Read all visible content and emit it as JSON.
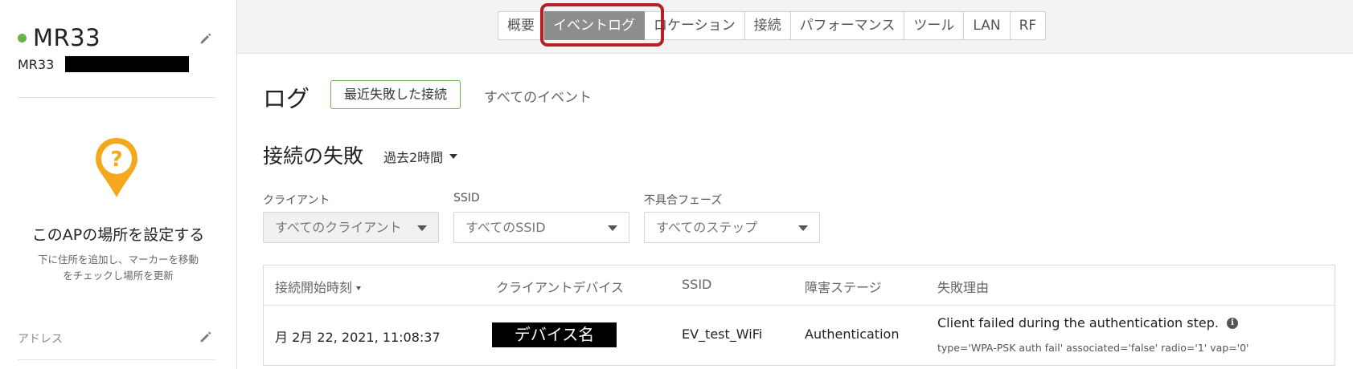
{
  "sidebar": {
    "ap_name": "MR33",
    "ap_model": "MR33",
    "location_title": "このAPの場所を設定する",
    "location_desc_line1": "下に住所を追加し、マーカーを移動",
    "location_desc_line2": "をチェックし場所を更新",
    "address_label": "アドレス"
  },
  "tabs": [
    {
      "label": "概要"
    },
    {
      "label": "イベントログ",
      "active": true
    },
    {
      "label": "ロケーション"
    },
    {
      "label": "接続"
    },
    {
      "label": "パフォーマンス"
    },
    {
      "label": "ツール"
    },
    {
      "label": "LAN"
    },
    {
      "label": "RF"
    }
  ],
  "log": {
    "title": "ログ",
    "tab_recent_failed": "最近失敗した接続",
    "tab_all_events": "すべてのイベント"
  },
  "failures": {
    "title": "接続の失敗",
    "time_range": "過去2時間"
  },
  "filters": {
    "client_label": "クライアント",
    "client_value": "すべてのクライアント",
    "ssid_label": "SSID",
    "ssid_value": "すべてのSSID",
    "phase_label": "不具合フェーズ",
    "phase_value": "すべてのステップ"
  },
  "table": {
    "columns": [
      "接続開始時刻",
      "クライアントデバイス",
      "SSID",
      "障害ステージ",
      "失敗理由"
    ],
    "rows": [
      {
        "time": "月 2月 22, 2021, 11:08:37",
        "device": "デバイス名",
        "ssid": "EV_test_WiFi",
        "stage": "Authentication",
        "reason": "Client failed during the authentication step.",
        "reason_detail": "type='WPA-PSK auth fail' associated='false' radio='1' vap='0'"
      }
    ]
  },
  "colors": {
    "status_online": "#67b346",
    "active_tab": "#8d8d8d",
    "highlight": "#b52025",
    "pin": "#f4a81d",
    "accent_green": "#6fb24c"
  }
}
